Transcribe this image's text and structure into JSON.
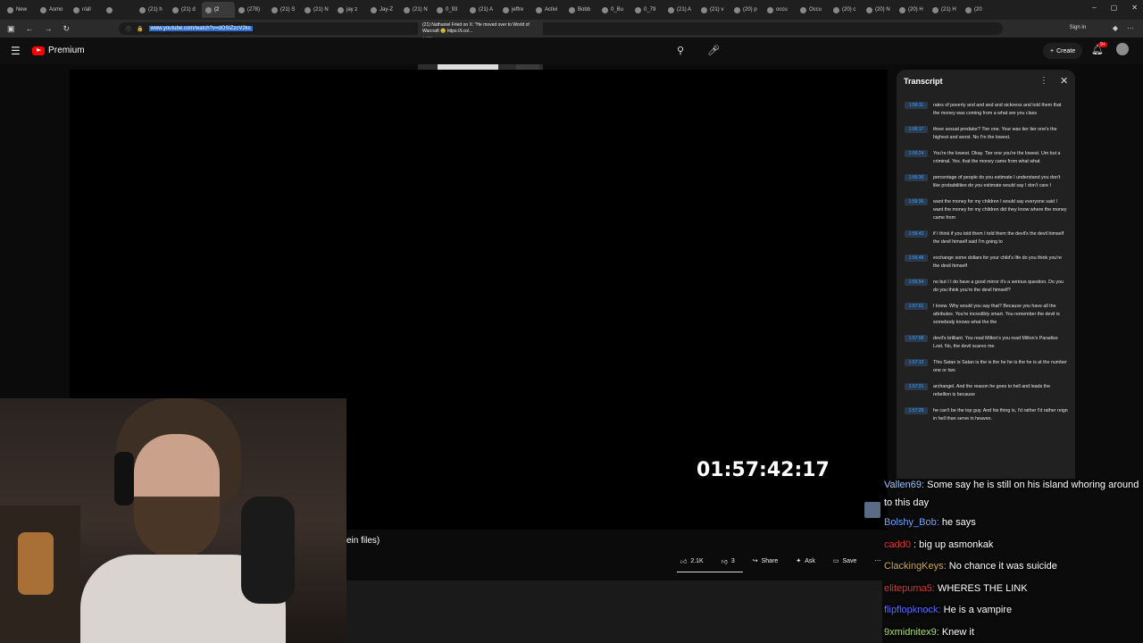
{
  "browser": {
    "tabs": [
      {
        "label": "New",
        "active": false
      },
      {
        "label": "Asmo",
        "active": false
      },
      {
        "label": "r/all",
        "active": false
      },
      {
        "label": "",
        "active": false
      },
      {
        "label": "(21) h",
        "active": false
      },
      {
        "label": "(21) d",
        "active": false
      },
      {
        "label": "(2",
        "active": true
      },
      {
        "label": "(278)",
        "active": false
      },
      {
        "label": "(21) S",
        "active": false
      },
      {
        "label": "(21) N",
        "active": false
      },
      {
        "label": "jay z",
        "active": false
      },
      {
        "label": "Jay-Z",
        "active": false
      },
      {
        "label": "(21) N",
        "active": false
      },
      {
        "label": "0_93",
        "active": false
      },
      {
        "label": "(21) A",
        "active": false
      },
      {
        "label": "jeffre",
        "active": false
      },
      {
        "label": "Activi",
        "active": false
      },
      {
        "label": "Bobb",
        "active": false
      },
      {
        "label": "0_Bu",
        "active": false
      },
      {
        "label": "0_79",
        "active": false
      },
      {
        "label": "(21) A",
        "active": false
      },
      {
        "label": "(21) v",
        "active": false
      },
      {
        "label": "(20) p",
        "active": false
      },
      {
        "label": "occu",
        "active": false
      },
      {
        "label": "Occu",
        "active": false
      },
      {
        "label": "(20) c",
        "active": false
      },
      {
        "label": "(20) N",
        "active": false
      },
      {
        "label": "(20) H",
        "active": false
      },
      {
        "label": "(21) H",
        "active": false
      },
      {
        "label": "(20",
        "active": false
      }
    ],
    "url": "www.youtube.com/watch?v=dOSlZzcV2ks",
    "sign_in": "Sign in",
    "preview": {
      "title": "(21) Nathaniel Fried on X: \"He moved over to World of Warcraft 😢 https://t.co/...",
      "domain": "x.com"
    }
  },
  "youtube": {
    "brand": "Premium",
    "create_label": "Create",
    "notif_count": "9+",
    "video_timecode": "01:57:42:17",
    "video_title_fragment": "ein files)",
    "actions": {
      "like": "2.1K",
      "dislike": "3",
      "share": "Share",
      "ask": "Ask",
      "save": "Save"
    }
  },
  "transcript": {
    "title": "Transcript",
    "segments": [
      {
        "time": "1:56:11",
        "text": "rates of poverty and and and and sickness and told them that the money was coming from a what are you class"
      },
      {
        "time": "1:56:17",
        "text": "three sexual predator? Tier one. Your was tier tier one's the highest and worst. No I'm the lowest."
      },
      {
        "time": "1:56:24",
        "text": "You're the lowest. Okay. Tier one you're the lowest. Um but a criminal. Yes. that the money came from what what"
      },
      {
        "time": "1:56:30",
        "text": "percentage of people do you estimate I understand you don't like probabilities do you estimate would say I don't care I"
      },
      {
        "time": "1:56:36",
        "text": "want the money for my children I would say everyone said I want the money for my children did they know where the money came from"
      },
      {
        "time": "1:56:42",
        "text": "if I think if you told them I told them the devil's the devil himself the devil himself said I'm going to"
      },
      {
        "time": "1:56:48",
        "text": "exchange some dollars for your child's life do you think you're the devil himself"
      },
      {
        "time": "1:56:54",
        "text": "no but I I do have a good mirror it's a serious question. Do you do you think you're the devil himself?"
      },
      {
        "time": "1:57:01",
        "text": "I know. Why would you say that? Because you have all the attributes. You're incredibly smart. You remember the devil is somebody knows what the the"
      },
      {
        "time": "1:57:08",
        "text": "devil's brilliant. You read Milton's you read Milton's Paradise Lost. No, the devil scares me."
      },
      {
        "time": "1:57:13",
        "text": "This Satan is Satan is the is the he he is the he is at the number one or two"
      },
      {
        "time": "1:57:21",
        "text": "archangel. And the reason he goes to hell and leads the rebellion is because"
      },
      {
        "time": "1:57:28",
        "text": "he can't be the top guy. And his thing is, I'd rather I'd rather reign in hell than serve in heaven."
      }
    ]
  },
  "chat": {
    "messages": [
      {
        "user": "Vallen69:",
        "text": "Some say he is still on his island whoring around to this day",
        "color": "#9ec8ff"
      },
      {
        "user": "Bolshy_Bob:",
        "text": "he says",
        "color": "#6aa9ff"
      },
      {
        "user": "cadd0",
        "text": ": big up asmonkak",
        "color": "#d83a3a"
      },
      {
        "user": "ClackingKeys:",
        "text": "No chance it was suicide",
        "color": "#d4a84a"
      },
      {
        "user": "elitepuma5:",
        "text": "WHERES THE LINK",
        "color": "#d83a3a"
      },
      {
        "user": "flipflopknock:",
        "text": "He is a vampire",
        "color": "#5b6bff"
      },
      {
        "user": "9xmidnitex9:",
        "text": "Knew it",
        "color": "#a8e06a"
      }
    ]
  }
}
